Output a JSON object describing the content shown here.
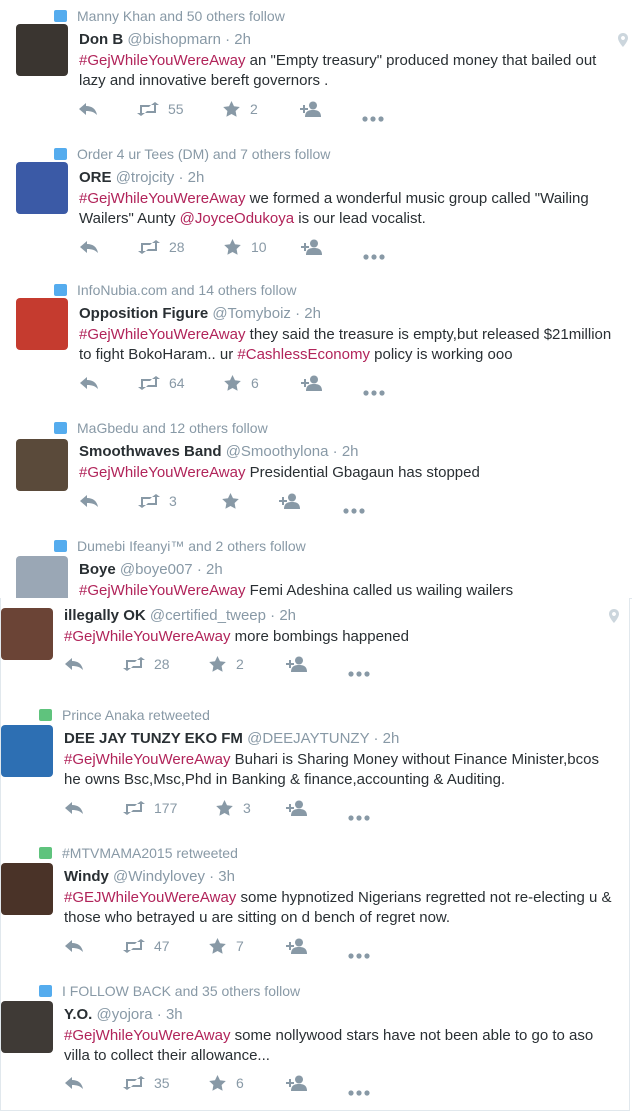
{
  "tweets": [
    {
      "context": "Manny Khan and 50 others follow",
      "context_type": "follow",
      "name": "Don B",
      "handle": "@bishopmarn",
      "time": "· 2h",
      "parts": [
        {
          "t": "#GejWhileYouWereAway",
          "k": "tag"
        },
        {
          "t": " an \"Empty treasury\" produced money that bailed out lazy and innovative bereft governors .",
          "k": "p"
        }
      ],
      "retweets": "55",
      "favorites": "2",
      "geo": true,
      "avatar_color": "#3a3530"
    },
    {
      "context": "Order 4 ur Tees (DM) and 7 others follow",
      "context_type": "follow",
      "name": "ORE",
      "handle": "@trojcity",
      "time": "· 2h",
      "parts": [
        {
          "t": "#GejWhileYouWereAway",
          "k": "tag"
        },
        {
          "t": " we formed a wonderful music group called \"Wailing Wailers\" Aunty ",
          "k": "p"
        },
        {
          "t": "@JoyceOdukoya",
          "k": "mention"
        },
        {
          "t": " is our lead vocalist.",
          "k": "p"
        }
      ],
      "retweets": "28",
      "favorites": "10",
      "geo": false,
      "avatar_color": "#3b5aa6"
    },
    {
      "context": "InfoNubia.com and 14 others follow",
      "context_type": "follow",
      "name": "Opposition Figure",
      "handle": "@Tomyboiz",
      "time": "· 2h",
      "parts": [
        {
          "t": "#GejWhileYouWereAway",
          "k": "tag"
        },
        {
          "t": " they said the treasure is empty,but released $21million to fight BokoHaram.. ur ",
          "k": "p"
        },
        {
          "t": "#CashlessEconomy",
          "k": "tag2"
        },
        {
          "t": " policy is working ooo",
          "k": "p"
        }
      ],
      "retweets": "64",
      "favorites": "6",
      "geo": false,
      "avatar_color": "#c53b2f"
    },
    {
      "context": "MaGbedu and 12 others follow",
      "context_type": "follow",
      "name": "Smoothwaves Band",
      "handle": "@Smoothylona",
      "time": "· 2h",
      "parts": [
        {
          "t": "#GejWhileYouWereAway",
          "k": "tag"
        },
        {
          "t": " Presidential Gbagaun has stopped",
          "k": "p"
        }
      ],
      "retweets": "3",
      "favorites": "",
      "geo": false,
      "avatar_color": "#5a4a3a"
    },
    {
      "context": "Dumebi Ifeanyi™ and 2 others follow",
      "context_type": "follow",
      "name": "Boye",
      "handle": "@boye007",
      "time": "· 2h",
      "parts": [
        {
          "t": "#GejWhileYouWereAway",
          "k": "tag"
        },
        {
          "t": " Femi Adeshina called us wailing wailers",
          "k": "p"
        }
      ],
      "retweets": "",
      "favorites": "",
      "geo": false,
      "avatar_color": "#9aa7b5"
    },
    {
      "context": "",
      "context_type": "",
      "name": "illegally OK",
      "handle": "@certified_tweep",
      "time": "· 2h",
      "parts": [
        {
          "t": "#GejWhileYouWereAway",
          "k": "tag"
        },
        {
          "t": " more bombings happened",
          "k": "p"
        }
      ],
      "retweets": "28",
      "favorites": "2",
      "geo": true,
      "avatar_color": "#6b4436"
    },
    {
      "context": "Prince Anaka retweeted",
      "context_type": "retweet",
      "name": "DEE JAY TUNZY EKO FM",
      "handle": "@DEEJAYTUNZY",
      "time": "· 2h",
      "parts": [
        {
          "t": "#GejWhileYouWereAway",
          "k": "tag"
        },
        {
          "t": " Buhari is Sharing Money without Finance Minister,bcos he owns Bsc,Msc,Phd in Banking & finance,accounting & Auditing.",
          "k": "p"
        }
      ],
      "retweets": "177",
      "favorites": "3",
      "geo": false,
      "avatar_color": "#2d6fb3"
    },
    {
      "context": "#MTVMAMA2015 retweeted",
      "context_type": "retweet",
      "name": "Windy",
      "handle": "@Windylovey",
      "time": "· 3h",
      "parts": [
        {
          "t": "#GEJWhileYouWereAway",
          "k": "tag"
        },
        {
          "t": " some hypnotized Nigerians regretted not re-electing u & those who betrayed u are sitting on d bench of regret now.",
          "k": "p"
        }
      ],
      "retweets": "47",
      "favorites": "7",
      "geo": false,
      "avatar_color": "#4a3328"
    },
    {
      "context": "I FOLLOW BACK and 35 others follow",
      "context_type": "follow",
      "name": "Y.O.",
      "handle": "@yojora",
      "time": "· 3h",
      "parts": [
        {
          "t": "#GejWhileYouWereAway",
          "k": "tag"
        },
        {
          "t": " some nollywood stars have not been able to go to aso villa to collect their allowance...",
          "k": "p"
        }
      ],
      "retweets": "35",
      "favorites": "6",
      "geo": false,
      "avatar_color": "#3f3a36"
    }
  ],
  "colors": {
    "hashtag": "#b1245a",
    "muted": "#8899a6",
    "follow_icon": "#55acee",
    "retweet_icon": "#5fc37d"
  },
  "icons": {
    "reply": "reply-icon",
    "retweet": "retweet-icon",
    "favorite": "star-icon",
    "follow": "add-user-icon",
    "more": "more-icon",
    "geo": "location-pin-icon"
  }
}
